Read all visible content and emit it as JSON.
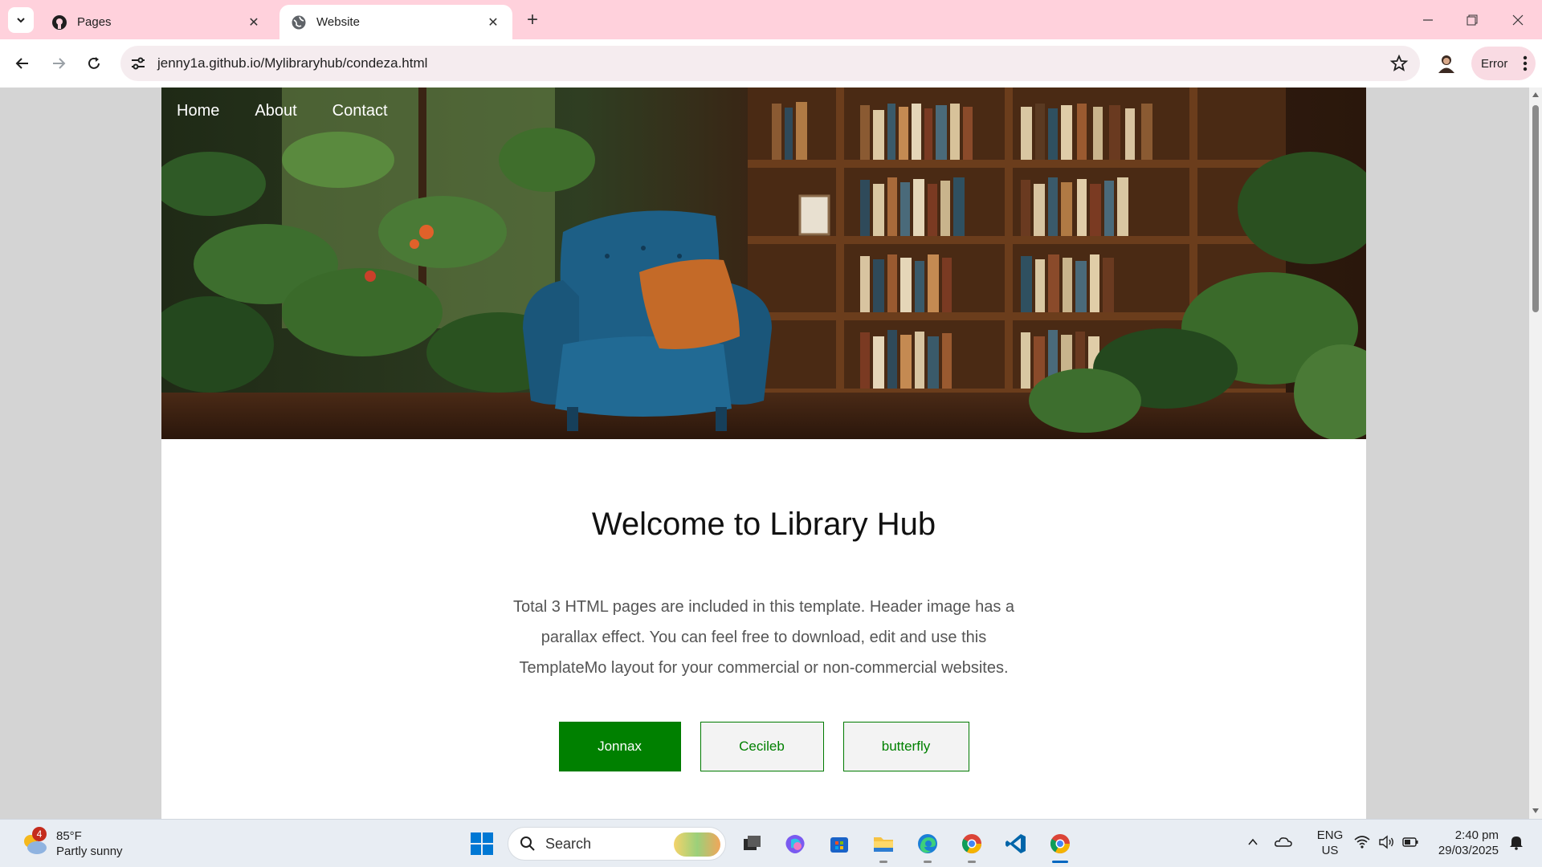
{
  "browser": {
    "tabs": [
      {
        "title": "Pages",
        "favicon": "github-icon",
        "active": false
      },
      {
        "title": "Website",
        "favicon": "globe-icon",
        "active": true
      }
    ],
    "address": "jenny1a.github.io/Mylibraryhub/condeza.html",
    "profile_status": "Error"
  },
  "site": {
    "nav": [
      "Home",
      "About",
      "Contact"
    ],
    "heading": "Welcome to Library Hub",
    "description": "Total 3 HTML pages are included in this template. Header image has a parallax effect. You can feel free to download, edit and use this TemplateMo layout for your commercial or non-commercial websites.",
    "buttons": [
      "Jonnax",
      "Cecileb",
      "butterfly"
    ],
    "accent": "#008000"
  },
  "taskbar": {
    "weather": {
      "temp": "85°F",
      "condition": "Partly sunny",
      "badge": "4"
    },
    "search_placeholder": "Search",
    "language": {
      "line1": "ENG",
      "line2": "US"
    },
    "clock": {
      "time": "2:40 pm",
      "date": "29/03/2025"
    }
  }
}
